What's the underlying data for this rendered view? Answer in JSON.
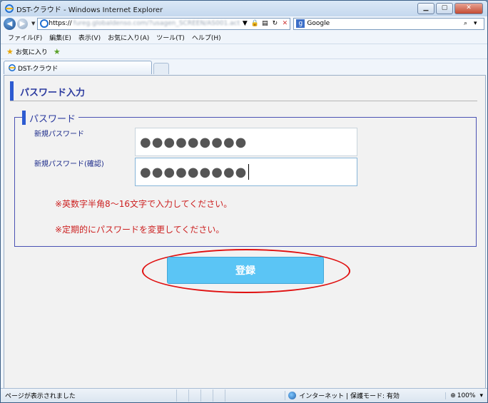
{
  "window": {
    "title": "DST-クラウド - Windows Internet Explorer",
    "min_label": "▁",
    "max_label": "▢",
    "close_label": "✕"
  },
  "address": {
    "url_prefix": "https://",
    "url_rest": "fureg.globaldenso.com/?usagen_SCREEN/AS001.action",
    "search_engine": "Google"
  },
  "menu": [
    "ファイル(F)",
    "編集(E)",
    "表示(V)",
    "お気に入り(A)",
    "ツール(T)",
    "ヘルプ(H)"
  ],
  "favorites": {
    "label": "お気に入り"
  },
  "tab": {
    "label": "DST-クラウド"
  },
  "page": {
    "header": "パスワード入力",
    "fieldset_legend": "パスワード",
    "new_password_label": "新規パスワード",
    "new_password_value": "●●●●●●●●●",
    "confirm_password_label": "新規パスワード(確認)",
    "confirm_password_value": "●●●●●●●●●",
    "note_1": "※英数字半角8～16文字で入力してください。",
    "note_2": "※定期的にパスワードを変更してください。",
    "submit_label": "登録"
  },
  "status": {
    "text": "ページが表示されました",
    "zone": "インターネット | 保護モード: 有効",
    "zoom": "100%"
  },
  "colors": {
    "accent_blue": "#2d5bd1",
    "submit_bg": "#5bc5f5",
    "note_red": "#cc1f1f",
    "highlight_ellipse": "#e01010"
  }
}
